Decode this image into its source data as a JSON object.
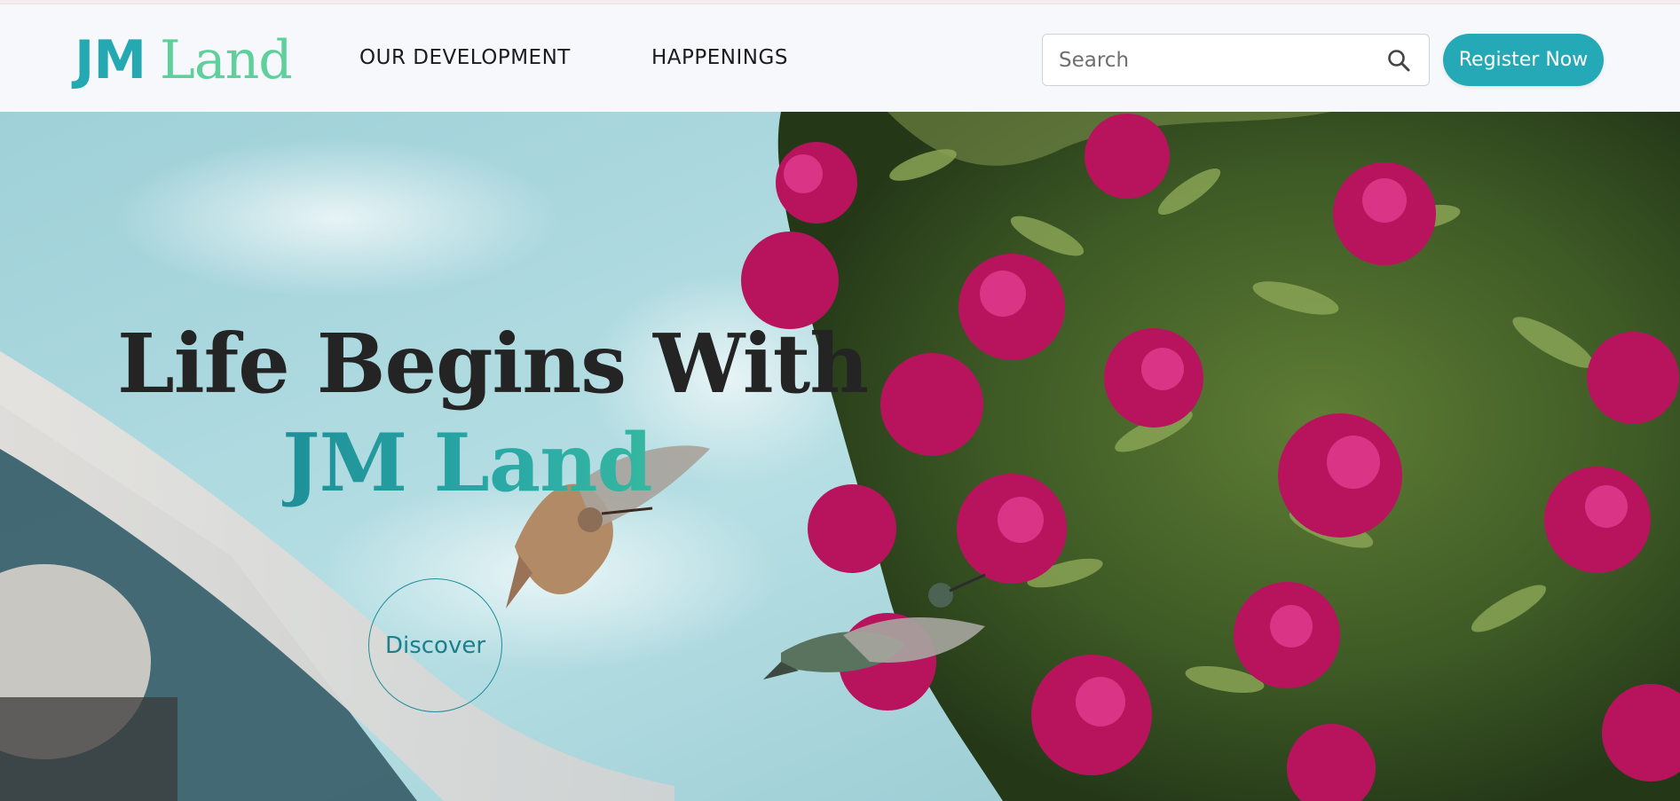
{
  "brand": {
    "logo_jm": "JM",
    "logo_land": "Land"
  },
  "nav": {
    "our_development": "OUR DEVELOPMENT",
    "happenings": "HAPPENINGS"
  },
  "search": {
    "placeholder": "Search",
    "value": "",
    "icon": "search-icon"
  },
  "register": {
    "label": "Register Now"
  },
  "hero": {
    "title_line1": "Life Begins With",
    "title_line2": "JM Land",
    "discover_label": "Discover"
  },
  "colors": {
    "brand_teal": "#25a9b6",
    "brand_green": "#5fcf9c",
    "title_dark": "#242424",
    "accent_teal": "#1f8d97"
  }
}
